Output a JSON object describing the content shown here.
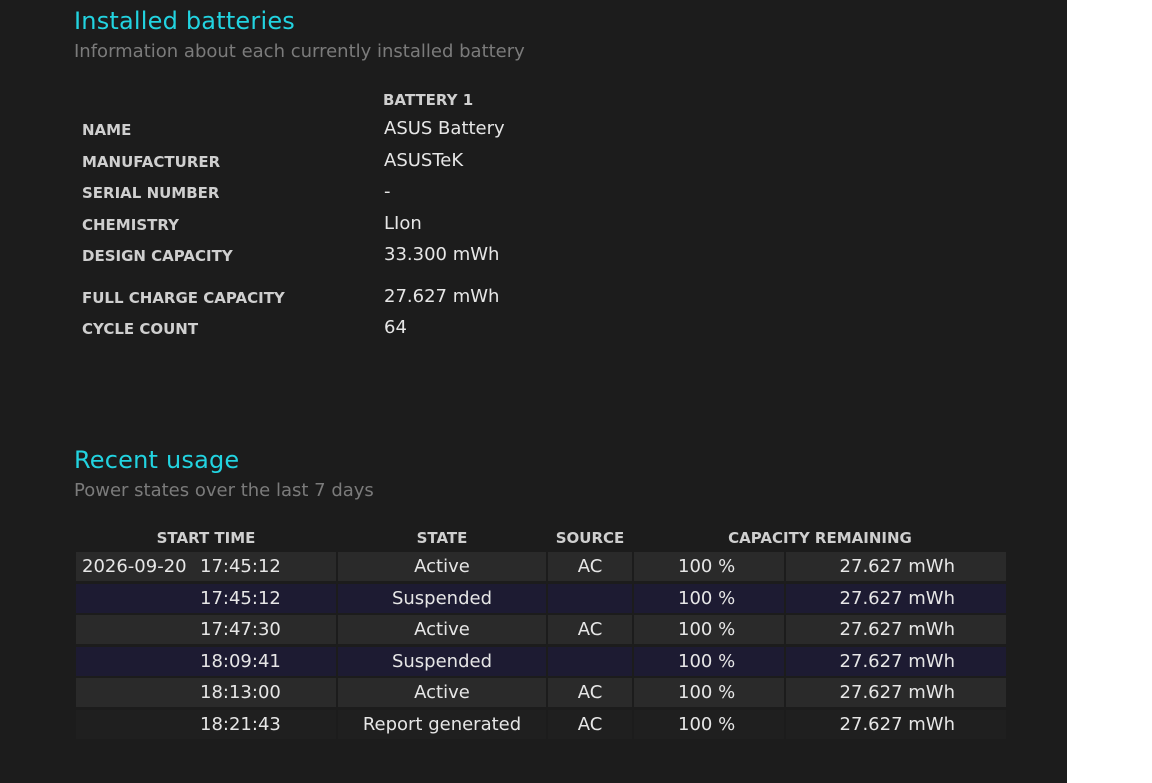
{
  "installed": {
    "title": "Installed batteries",
    "subtitle": "Information about each currently installed battery",
    "column_header": "BATTERY 1",
    "rows": [
      {
        "label": "NAME",
        "value": "ASUS Battery"
      },
      {
        "label": "MANUFACTURER",
        "value": "ASUSTeK"
      },
      {
        "label": "SERIAL NUMBER",
        "value": "-"
      },
      {
        "label": "CHEMISTRY",
        "value": "LIon"
      },
      {
        "label": "DESIGN CAPACITY",
        "value": "33.300 mWh"
      },
      {
        "label": "FULL CHARGE CAPACITY",
        "value": "27.627 mWh"
      },
      {
        "label": "CYCLE COUNT",
        "value": "64"
      }
    ]
  },
  "recent": {
    "title": "Recent usage",
    "subtitle": "Power states over the last 7 days",
    "headers": {
      "start_time": "START TIME",
      "state": "STATE",
      "source": "SOURCE",
      "capacity_remaining": "CAPACITY REMAINING"
    },
    "rows": [
      {
        "date": "2026-09-20",
        "time": "17:45:12",
        "state": "Active",
        "source": "AC",
        "percent": "100 %",
        "capacity": "27.627 mWh"
      },
      {
        "date": "",
        "time": "17:45:12",
        "state": "Suspended",
        "source": "",
        "percent": "100 %",
        "capacity": "27.627 mWh"
      },
      {
        "date": "",
        "time": "17:47:30",
        "state": "Active",
        "source": "AC",
        "percent": "100 %",
        "capacity": "27.627 mWh"
      },
      {
        "date": "",
        "time": "18:09:41",
        "state": "Suspended",
        "source": "",
        "percent": "100 %",
        "capacity": "27.627 mWh"
      },
      {
        "date": "",
        "time": "18:13:00",
        "state": "Active",
        "source": "AC",
        "percent": "100 %",
        "capacity": "27.627 mWh"
      },
      {
        "date": "",
        "time": "18:21:43",
        "state": "Report generated",
        "source": "AC",
        "percent": "100 %",
        "capacity": "27.627 mWh"
      }
    ]
  },
  "colors": {
    "background": "#1c1c1c",
    "title": "#22d3e0",
    "subtitle": "#7b7b7b",
    "row_odd": "#2a2a2a",
    "row_even": "#1d1b32"
  }
}
